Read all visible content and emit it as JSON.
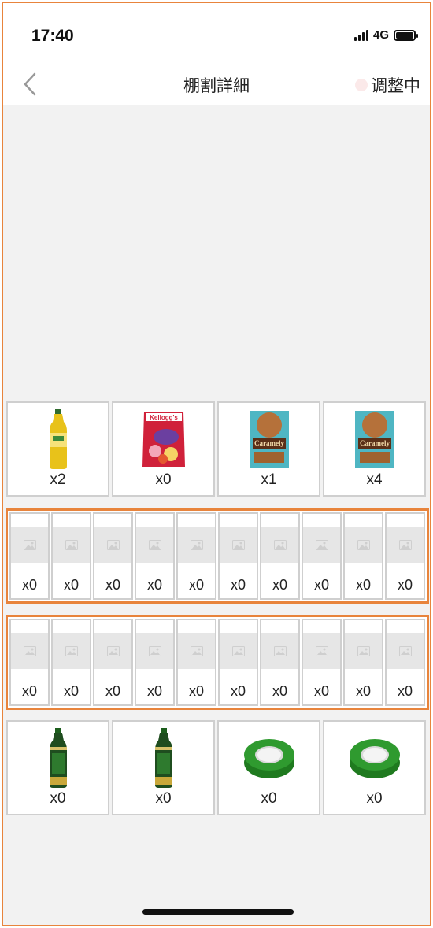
{
  "status_bar": {
    "time": "17:40",
    "network": "4G"
  },
  "nav": {
    "title": "棚割詳細",
    "status": "调整中"
  },
  "shelves": {
    "row_a": [
      {
        "product": "green-tea-bottle-icon",
        "count": "x2"
      },
      {
        "product": "cereal-bag-icon",
        "count": "x0"
      },
      {
        "product": "caramely-box-icon",
        "count": "x1"
      },
      {
        "product": "caramely-box-icon",
        "count": "x4"
      }
    ],
    "row_b": [
      "x0",
      "x0",
      "x0",
      "x0",
      "x0",
      "x0",
      "x0",
      "x0",
      "x0",
      "x0"
    ],
    "row_c": [
      "x0",
      "x0",
      "x0",
      "x0",
      "x0",
      "x0",
      "x0",
      "x0",
      "x0",
      "x0"
    ],
    "row_d": [
      {
        "product": "matcha-tea-bottle-icon",
        "count": "x0"
      },
      {
        "product": "matcha-tea-bottle-icon",
        "count": "x0"
      },
      {
        "product": "green-tape-roll-icon",
        "count": "x0"
      },
      {
        "product": "green-tape-roll-icon",
        "count": "x0"
      }
    ]
  },
  "colors": {
    "accent": "#e8843c",
    "background": "#f2f2f2",
    "cell_border": "#cfcfcf"
  }
}
